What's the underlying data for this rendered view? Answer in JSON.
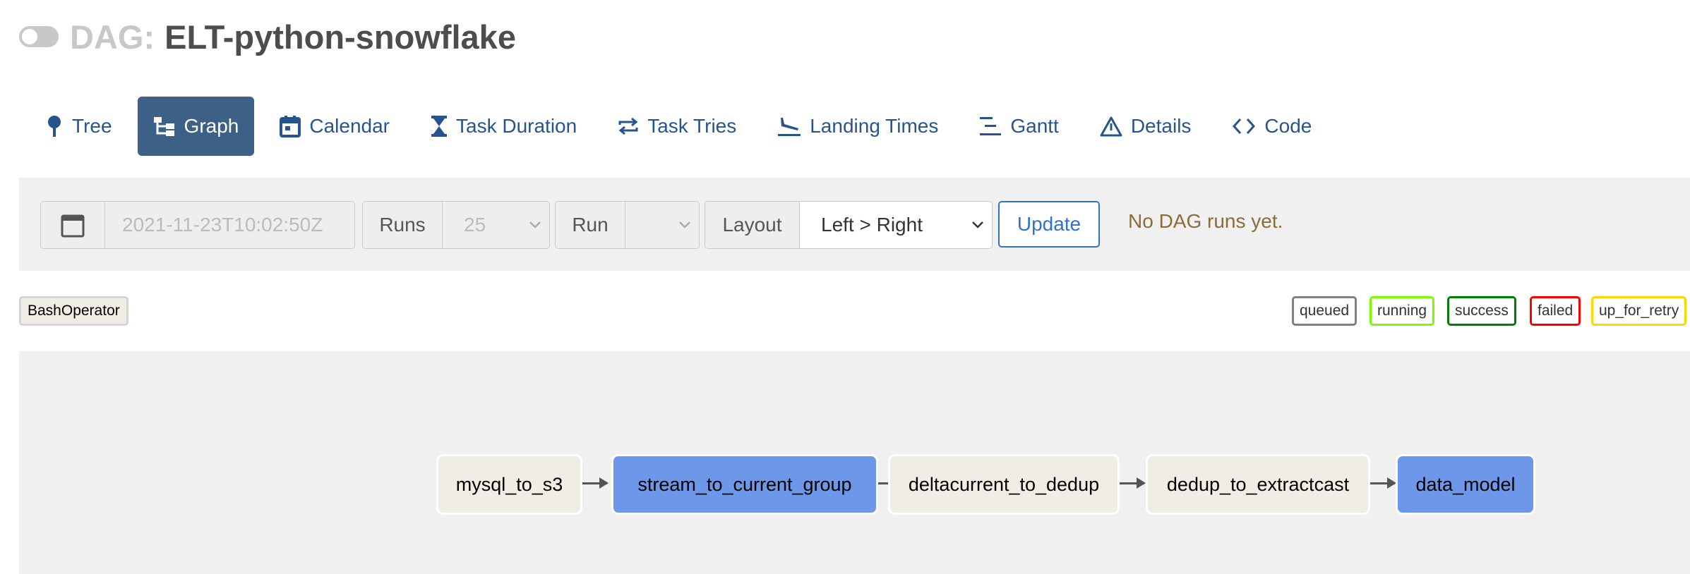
{
  "header": {
    "dag_prefix": "DAG:",
    "dag_name": "ELT-python-snowflake"
  },
  "nav": {
    "tabs": [
      {
        "label": "Tree",
        "icon": "tree-icon"
      },
      {
        "label": "Graph",
        "icon": "graph-icon",
        "active": true
      },
      {
        "label": "Calendar",
        "icon": "calendar-icon"
      },
      {
        "label": "Task Duration",
        "icon": "hourglass-icon"
      },
      {
        "label": "Task Tries",
        "icon": "retry-icon"
      },
      {
        "label": "Landing Times",
        "icon": "plane-landing-icon"
      },
      {
        "label": "Gantt",
        "icon": "gantt-icon"
      },
      {
        "label": "Details",
        "icon": "warning-triangle-icon"
      },
      {
        "label": "Code",
        "icon": "code-icon"
      }
    ]
  },
  "controls": {
    "base_date_placeholder": "2021-11-23T10:02:50Z",
    "runs_label": "Runs",
    "runs_value": "25",
    "run_label": "Run",
    "run_value": "",
    "layout_label": "Layout",
    "layout_value": "Left > Right",
    "update_label": "Update",
    "status_text": "No DAG runs yet."
  },
  "legend": {
    "operators": [
      "BashOperator"
    ],
    "states": [
      {
        "label": "queued",
        "color": "#808080"
      },
      {
        "label": "running",
        "color": "#7cfc00"
      },
      {
        "label": "success",
        "color": "#008000"
      },
      {
        "label": "failed",
        "color": "#ff0000"
      },
      {
        "label": "up_for_retry",
        "color": "#ffd700"
      }
    ]
  },
  "graph": {
    "nodes": [
      {
        "label": "mysql_to_s3",
        "type": "task",
        "color": "#f0ede4"
      },
      {
        "label": "stream_to_current_group",
        "type": "task-group",
        "color": "#6d97e8"
      },
      {
        "label": "deltacurrent_to_dedup",
        "type": "task",
        "color": "#f0ede4"
      },
      {
        "label": "dedup_to_extractcast",
        "type": "task",
        "color": "#f0ede4"
      },
      {
        "label": "data_model",
        "type": "task-group",
        "color": "#6d97e8"
      }
    ]
  },
  "colors": {
    "accent": "#3d6186",
    "link": "#28548e",
    "update_button": "#2f72cc",
    "status_text": "#8a6d3b",
    "panel_bg": "#f0f0f0"
  }
}
